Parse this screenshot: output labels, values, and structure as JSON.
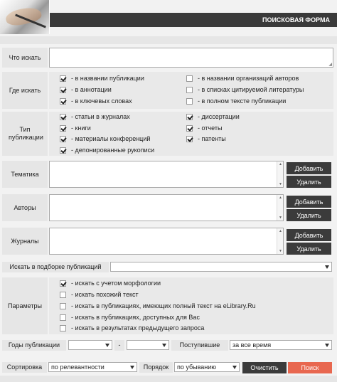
{
  "header": {
    "title": "ПОИСКОВАЯ ФОРМА"
  },
  "what": {
    "label": "Что искать",
    "value": ""
  },
  "where": {
    "label": "Где искать",
    "options": [
      {
        "label": "- в названии публикации",
        "checked": true
      },
      {
        "label": "- в аннотации",
        "checked": true
      },
      {
        "label": "- в ключевых словах",
        "checked": true
      },
      {
        "label": "- в названии организаций авторов",
        "checked": false
      },
      {
        "label": "- в списках цитируемой литературы",
        "checked": false
      },
      {
        "label": "- в полном тексте публикации",
        "checked": false
      }
    ]
  },
  "type": {
    "label": "Тип публикации",
    "options": [
      {
        "label": "- статьи в журналах",
        "checked": true
      },
      {
        "label": "- книги",
        "checked": true
      },
      {
        "label": "- материалы конференций",
        "checked": true
      },
      {
        "label": "- депонированные рукописи",
        "checked": true
      },
      {
        "label": "- диссертации",
        "checked": true
      },
      {
        "label": "- отчеты",
        "checked": true
      },
      {
        "label": "- патенты",
        "checked": true
      }
    ]
  },
  "theme": {
    "label": "Тематика",
    "add": "Добавить",
    "remove": "Удалить"
  },
  "authors": {
    "label": "Авторы",
    "add": "Добавить",
    "remove": "Удалить"
  },
  "journals": {
    "label": "Журналы",
    "add": "Добавить",
    "remove": "Удалить"
  },
  "collection": {
    "label": "Искать в подборке публикаций",
    "value": ""
  },
  "params": {
    "label": "Параметры",
    "options": [
      {
        "label": "- искать с учетом морфологии",
        "checked": true
      },
      {
        "label": "- искать похожий текст",
        "checked": false
      },
      {
        "label": "- искать в публикациях, имеющих полный текст на eLibrary.Ru",
        "checked": false
      },
      {
        "label": "- искать в публикациях, доступных для Вас",
        "checked": false
      },
      {
        "label": "- искать в результатах предыдущего запроса",
        "checked": false
      }
    ]
  },
  "years": {
    "label": "Годы публикации",
    "from": "",
    "dash": "-",
    "to": "",
    "received_label": "Поступившие",
    "received_value": "за все время"
  },
  "sort": {
    "label": "Сортировка",
    "value": "по релевантности",
    "order_label": "Порядок",
    "order_value": "по убыванию",
    "clear": "Очистить",
    "search": "Поиск"
  },
  "colors": {
    "search_button": "#e8674f",
    "dark": "#3b3b3b"
  }
}
